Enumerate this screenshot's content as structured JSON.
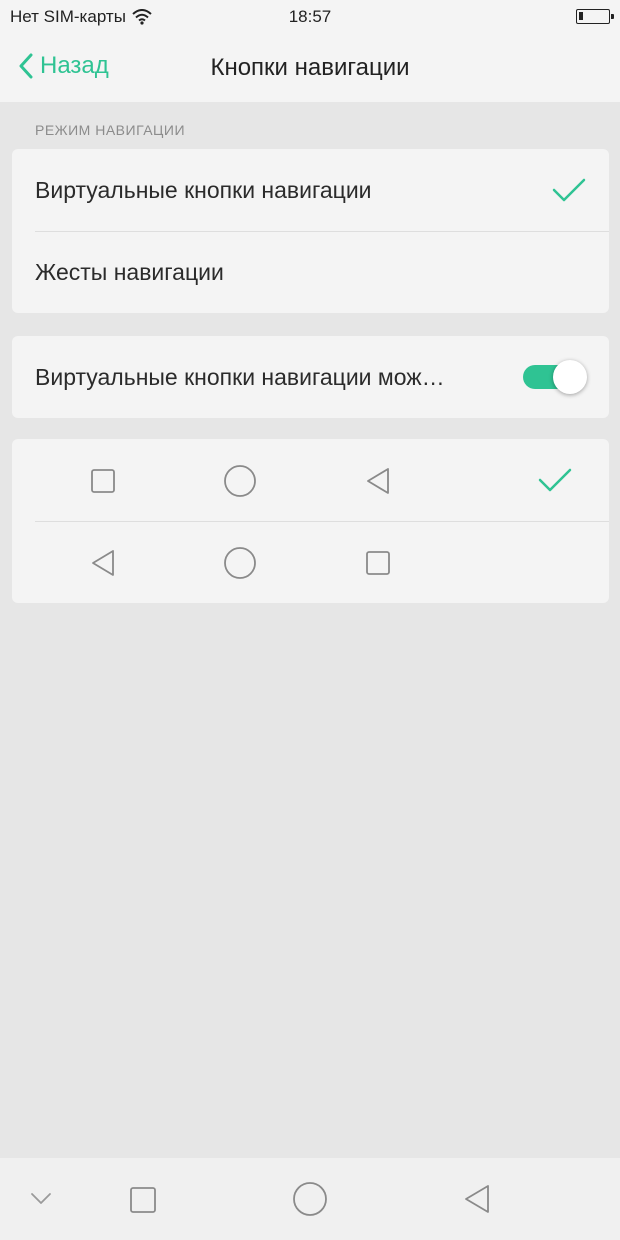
{
  "status_bar": {
    "carrier": "Нет SIM-карты",
    "time": "18:57",
    "wifi_icon": "wifi-icon",
    "battery_icon": "battery-icon",
    "battery_level": 0.15
  },
  "header": {
    "back_label": "Назад",
    "title": "Кнопки навигации"
  },
  "sections": {
    "mode_label": "РЕЖИМ НАВИГАЦИИ",
    "mode_options": [
      {
        "label": "Виртуальные кнопки навигации",
        "selected": true
      },
      {
        "label": "Жесты навигации",
        "selected": false
      }
    ],
    "hide_toggle": {
      "label": "Виртуальные кнопки навигации мож…",
      "on": true
    },
    "layouts": [
      {
        "icons": [
          "square-icon",
          "circle-icon",
          "triangle-back-icon"
        ],
        "selected": true
      },
      {
        "icons": [
          "triangle-back-icon",
          "circle-icon",
          "square-icon"
        ],
        "selected": false
      }
    ]
  },
  "system_nav": {
    "icons": [
      "chevron-down-icon",
      "square-icon",
      "circle-icon",
      "triangle-back-icon"
    ]
  },
  "colors": {
    "accent": "#2fc393",
    "background": "#e6e6e6",
    "card": "#f4f4f4"
  }
}
